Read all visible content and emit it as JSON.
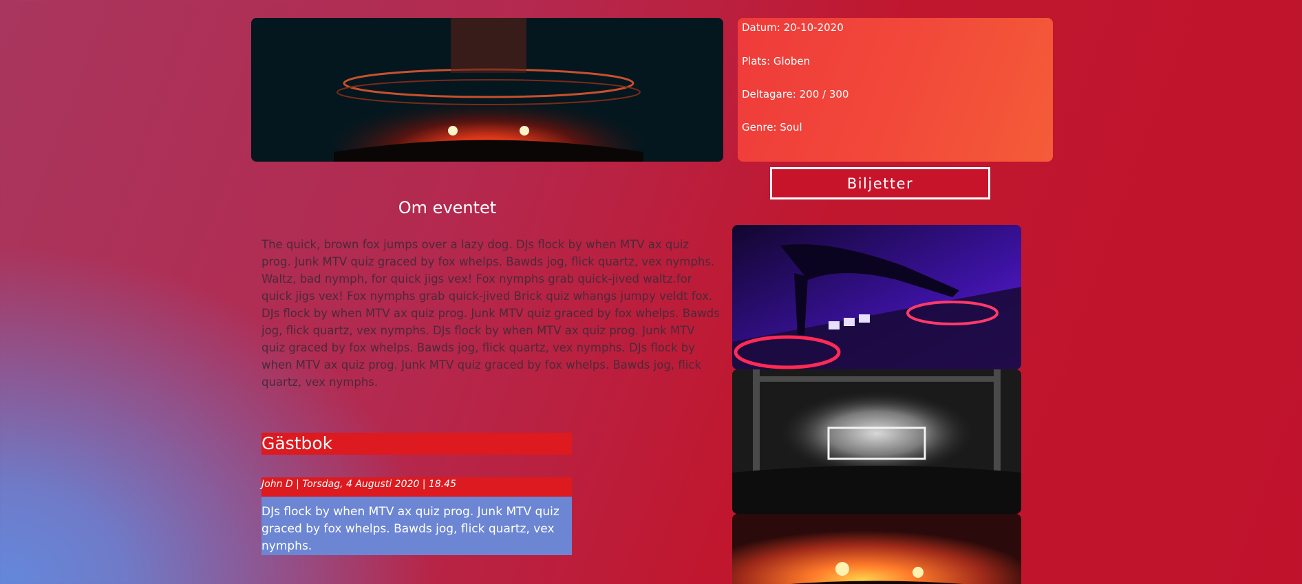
{
  "event": {
    "date_label": "Datum: 20-10-2020",
    "place_label": "Plats: Globen",
    "participants_label": "Deltagare: 200 / 300",
    "genre_label": "Genre: Soul"
  },
  "tickets_button_label": "Biljetter",
  "about": {
    "heading": "Om eventet",
    "text": "The quick, brown fox jumps over a lazy dog. DJs flock by when MTV ax quiz prog. Junk MTV quiz graced by fox whelps. Bawds jog, flick quartz, vex nymphs. Waltz, bad nymph, for quick jigs vex! Fox nymphs grab quick-jived waltz.for quick jigs vex! Fox nymphs grab quick-jived Brick quiz whangs jumpy veldt fox. DJs flock by when MTV ax quiz prog. Junk MTV quiz graced by fox whelps. Bawds jog, flick quartz, vex nymphs. DJs flock by when MTV ax quiz prog. Junk MTV quiz graced by fox whelps. Bawds jog, flick quartz, vex nymphs. DJs flock by when MTV ax quiz prog. Junk MTV quiz graced by fox whelps. Bawds jog, flick quartz, vex nymphs."
  },
  "guestbook": {
    "title": "Gästbok",
    "entries": [
      {
        "meta": "John D | Torsdag, 4 Augusti 2020 | 18.45",
        "text": "DJs flock by when MTV ax quiz prog. Junk MTV quiz graced by fox whelps. Bawds jog, flick quartz, vex nymphs."
      }
    ]
  },
  "images": {
    "hero": "concert-stage-photo",
    "gallery": [
      "dj-mixer-photo",
      "stage-smoke-photo",
      "crowd-lights-photo"
    ]
  },
  "colors": {
    "accent_red": "#dc1a1f",
    "info_card": "#f2483a",
    "comment_blue": "#6c86d4"
  }
}
